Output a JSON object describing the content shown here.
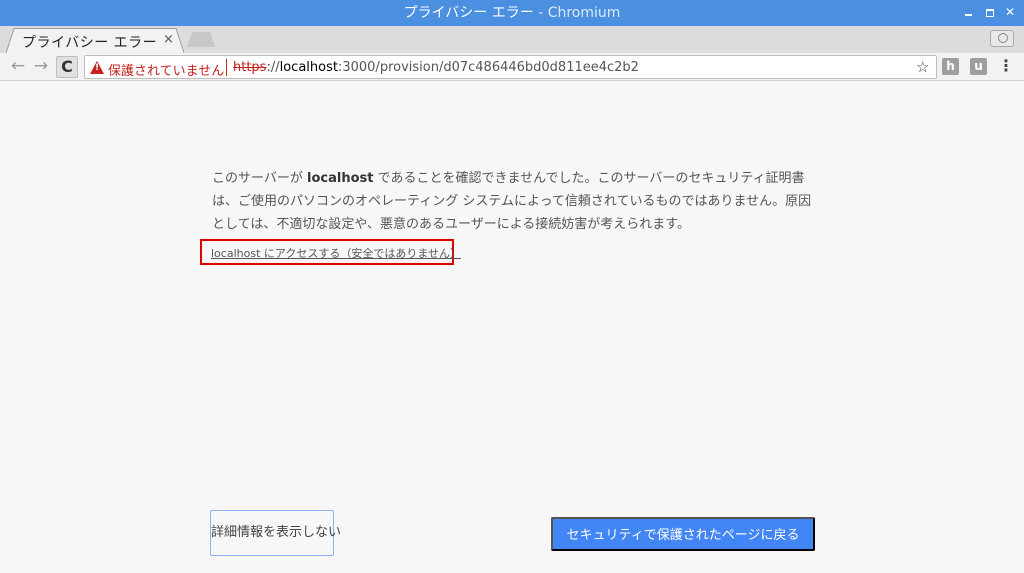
{
  "window": {
    "title": "プライバシー エラー",
    "app_name": "- Chromium",
    "close_glyph": "✕"
  },
  "tab": {
    "title": "プライバシー エラー",
    "close_glyph": "×"
  },
  "toolbar": {
    "back_glyph": "←",
    "forward_glyph": "→",
    "reload_glyph": "C",
    "security_label": "保護されていません",
    "url_scheme": "https",
    "url_sep": "://",
    "url_host": "localhost",
    "url_rest": ":3000/provision/d07c486446bd0d811ee4c2b2",
    "star_glyph": "☆",
    "ext_h": "h",
    "ext_u": "u",
    "menu_glyph": "⋮"
  },
  "page": {
    "text_before": "このサーバーが",
    "host": "localhost",
    "text_after": "であることを確認できませんでした。このサーバーのセキュリティ証明書は、ご使用のパソコンのオペレーティング システムによって信頼されているものではありません。原因としては、不適切な設定や、悪意のあるユーザーによる接続妨害が考えられます。",
    "proceed_link": "localhost にアクセスする（安全ではありません）",
    "details_button": "詳細情報を表示しない",
    "back_button": "セキュリティで保護されたページに戻る"
  },
  "colors": {
    "titlebar": "#4a8fe0",
    "warning_red": "#c5221f",
    "primary_blue": "#4285f4",
    "highlight_box": "#e00000"
  },
  "icons": {
    "warning": "warning-triangle-icon",
    "star": "star-icon",
    "menu": "more-vert-icon",
    "profile": "profile-icon"
  }
}
